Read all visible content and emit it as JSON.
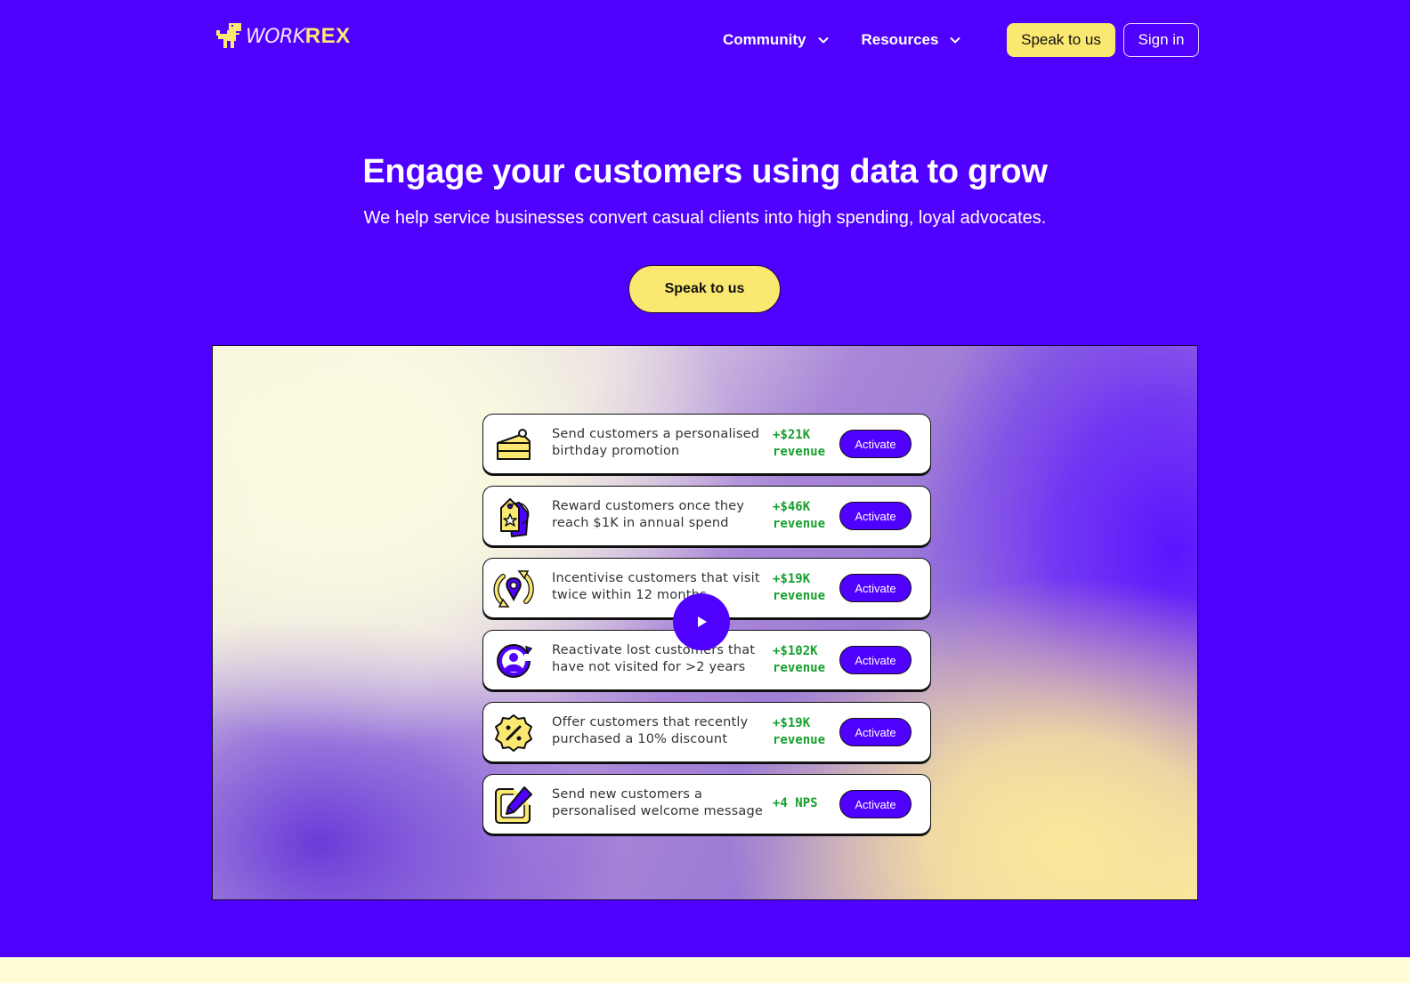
{
  "brand": {
    "name_part1": "WORK",
    "name_part2": "REX",
    "logo_icon": "dinosaur-icon"
  },
  "nav": {
    "items": [
      {
        "label": "Community",
        "icon": "chevron-down-icon"
      },
      {
        "label": "Resources",
        "icon": "chevron-down-icon"
      }
    ],
    "speak_label": "Speak to us",
    "signin_label": "Sign in"
  },
  "hero": {
    "title": "Engage your customers using data to grow",
    "subtitle": "We help service businesses convert casual clients into high spending, loyal advocates.",
    "cta_label": "Speak to us"
  },
  "video": {
    "play_icon": "play-icon",
    "cards": [
      {
        "icon": "cake-icon",
        "text": "Send customers a personalised birthday promotion",
        "value_line1": "+$21K",
        "value_line2": "revenue",
        "button": "Activate"
      },
      {
        "icon": "tag-icon",
        "text": "Reward customers once they reach $1K in annual spend",
        "value_line1": "+$46K",
        "value_line2": "revenue",
        "button": "Activate"
      },
      {
        "icon": "location-cycle-icon",
        "text": "Incentivise customers that visit twice within 12 months",
        "value_line1": "+$19K",
        "value_line2": "revenue",
        "button": "Activate"
      },
      {
        "icon": "user-refresh-icon",
        "text": "Reactivate lost customers that have not visited for >2 years",
        "value_line1": "+$102K",
        "value_line2": "revenue",
        "button": "Activate"
      },
      {
        "icon": "discount-badge-icon",
        "text": "Offer customers that recently purchased a 10% discount",
        "value_line1": "+$19K",
        "value_line2": "revenue",
        "button": "Activate"
      },
      {
        "icon": "edit-message-icon",
        "text": "Send new customers a personalised welcome message",
        "value_line1": "+4 NPS",
        "value_line2": "",
        "button": "Activate"
      }
    ]
  },
  "colors": {
    "brand_purple": "#5000ff",
    "brand_yellow": "#fbe870",
    "value_green": "#17a02d",
    "bottom_strip": "#fffdd6"
  }
}
